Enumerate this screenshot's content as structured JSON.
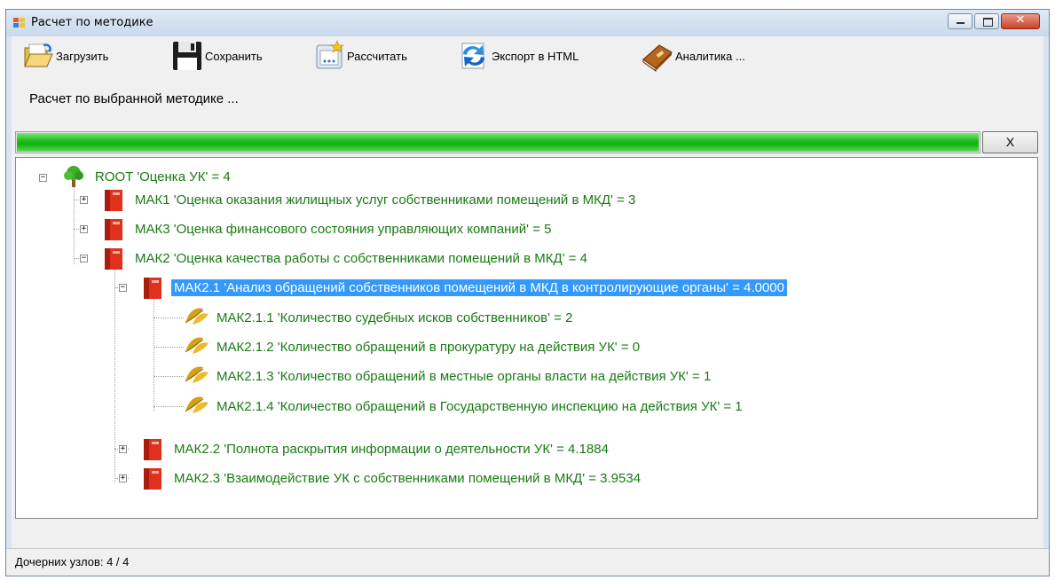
{
  "window": {
    "title": "Расчет по методике"
  },
  "toolbar": {
    "load_label": "Загрузить",
    "save_label": "Сохранить",
    "calc_label": "Рассчитать",
    "export_label": "Экспорт в HTML",
    "analytics_label": "Аналитика ..."
  },
  "subtitle": "Расчет по выбранной методике ...",
  "progress": {
    "percent": 100,
    "color": "#1fc11b"
  },
  "cancel_label": "X",
  "tree": {
    "root": "ROOT 'Оценка УК' = 4",
    "mak1": "МАК1 'Оценка оказания жилищных услуг собственниками помещений в МКД' = 3",
    "mak3": "МАК3 'Оценка финансового состояния управляющих компаний' = 5",
    "mak2": "МАК2 'Оценка качества работы с собственниками помещений в МКД' = 4",
    "mak21": "МАК2.1 'Анализ обращений собственников помещений в МКД в контролирующие органы' = 4.0000",
    "mak211": "МАК2.1.1 'Количество судебных исков собственников' = 2",
    "mak212": "МАК2.1.2 'Количество обращений в прокуратуру на действия УК' = 0",
    "mak213": "МАК2.1.3 'Количество обращений в местные органы власти на действия УК' = 1",
    "mak214": "МАК2.1.4 'Количество обращений в Государственную инспекцию на действия УК' = 1",
    "mak22": "МАК2.2 'Полнота раскрытия информации о деятельности УК' = 4.1884",
    "mak23": "МАК2.3 'Взаимодействие УК с собственниками помещений в МКД' = 3.9534"
  },
  "status": "Дочерних узлов: 4 / 4"
}
